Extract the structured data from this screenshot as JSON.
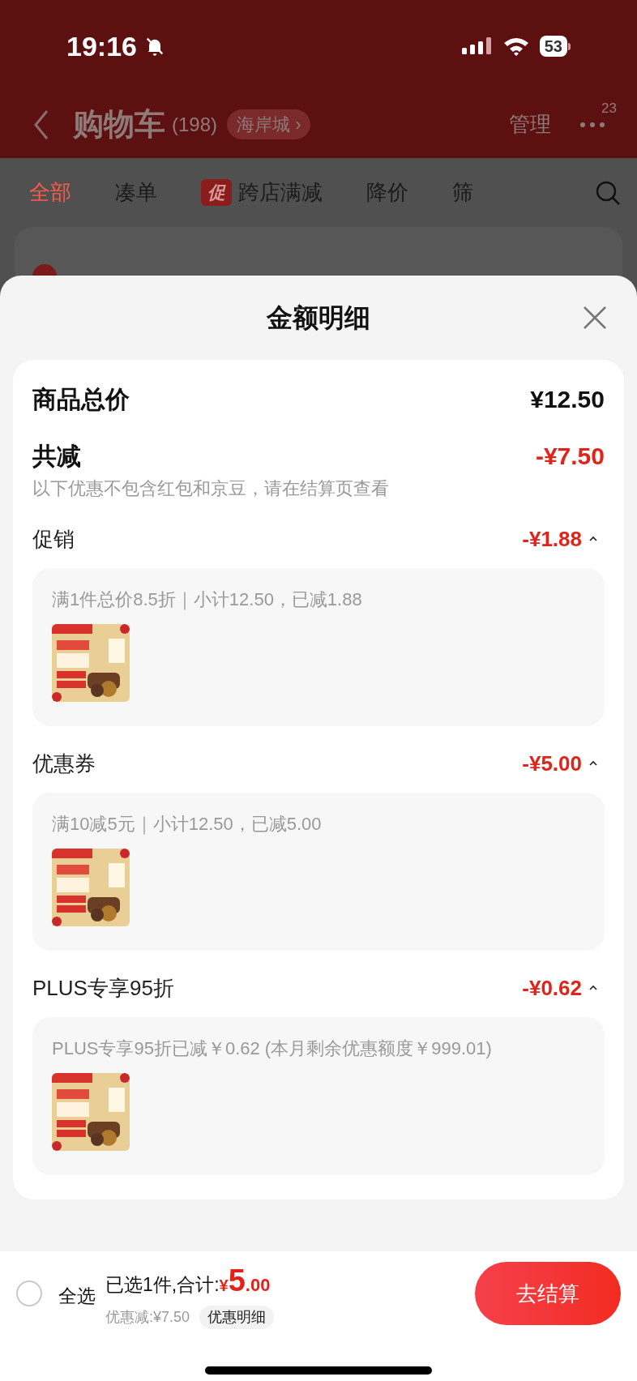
{
  "status_bar": {
    "time": "19:16",
    "battery": "53"
  },
  "header": {
    "title": "购物车",
    "count": "(198)",
    "location": "海岸城 ›",
    "manage": "管理",
    "more_badge": "23"
  },
  "filter_tabs": [
    {
      "label": "全部",
      "selected": true
    },
    {
      "label": "凑单",
      "selected": false
    },
    {
      "label": "跨店满减",
      "selected": false,
      "badge": "促"
    },
    {
      "label": "降价",
      "selected": false
    },
    {
      "label": "筛",
      "selected": false
    }
  ],
  "sheet": {
    "title": "金额明细",
    "total": {
      "label": "商品总价",
      "value": "¥12.50"
    },
    "reduction": {
      "label": "共减",
      "value": "-¥7.50",
      "note": "以下优惠不包含红包和京豆，请在结算页查看"
    },
    "sections": [
      {
        "label": "促销",
        "amount": "-¥1.88",
        "expanded": true,
        "detail": "满1件总价8.5折｜小计12.50，已减1.88"
      },
      {
        "label": "优惠券",
        "amount": "-¥5.00",
        "expanded": true,
        "detail": "满10减5元｜小计12.50，已减5.00"
      },
      {
        "label": "PLUS专享95折",
        "amount": "-¥0.62",
        "expanded": true,
        "detail": "PLUS专享95折已减￥0.62 (本月剩余优惠额度￥999.01)"
      }
    ]
  },
  "bottom_bar": {
    "select_all": {
      "label": "全选",
      "checked": false
    },
    "summary": "已选1件,合计:",
    "currency": "¥",
    "price_int": "5",
    "price_dec": ".00",
    "discount": "优惠减:¥7.50",
    "detail_button": "优惠明细",
    "checkout": "去结算"
  }
}
